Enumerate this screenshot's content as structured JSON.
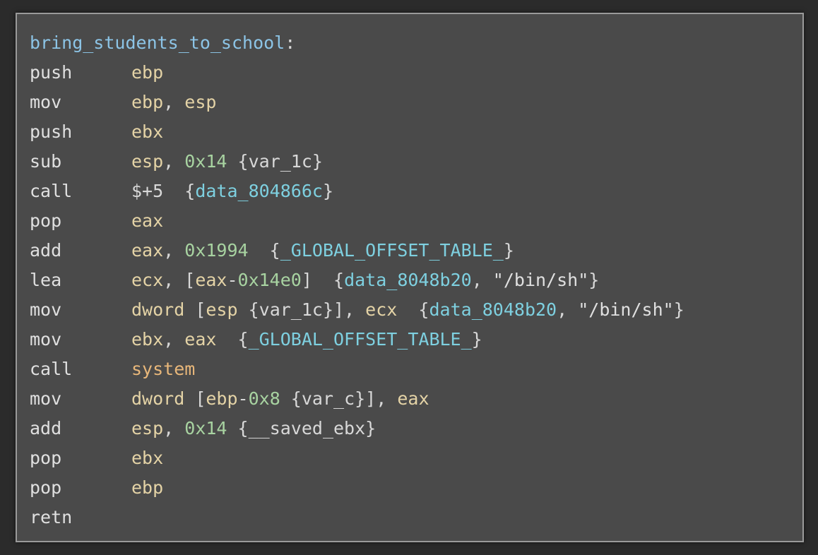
{
  "function_label": "bring_students_to_school",
  "lines": [
    [
      {
        "c": "label",
        "t": "bring_students_to_school"
      },
      {
        "c": "punc",
        "t": ":"
      }
    ],
    [
      {
        "c": "mn",
        "t": "push"
      },
      {
        "c": "reg",
        "t": "ebp"
      }
    ],
    [
      {
        "c": "mn",
        "t": "mov"
      },
      {
        "c": "reg",
        "t": "ebp"
      },
      {
        "c": "punc",
        "t": ", "
      },
      {
        "c": "reg",
        "t": "esp"
      }
    ],
    [
      {
        "c": "mn",
        "t": "push"
      },
      {
        "c": "reg",
        "t": "ebx"
      }
    ],
    [
      {
        "c": "mn",
        "t": "sub"
      },
      {
        "c": "reg",
        "t": "esp"
      },
      {
        "c": "punc",
        "t": ", "
      },
      {
        "c": "num",
        "t": "0x14"
      },
      {
        "c": "punc",
        "t": " {"
      },
      {
        "c": "var",
        "t": "var_1c"
      },
      {
        "c": "punc",
        "t": "}"
      }
    ],
    [
      {
        "c": "mn",
        "t": "call"
      },
      {
        "c": "punc",
        "t": "$+5  {"
      },
      {
        "c": "sym",
        "t": "data_804866c"
      },
      {
        "c": "punc",
        "t": "}"
      }
    ],
    [
      {
        "c": "mn",
        "t": "pop"
      },
      {
        "c": "reg",
        "t": "eax"
      }
    ],
    [
      {
        "c": "mn",
        "t": "add"
      },
      {
        "c": "reg",
        "t": "eax"
      },
      {
        "c": "punc",
        "t": ", "
      },
      {
        "c": "num",
        "t": "0x1994"
      },
      {
        "c": "punc",
        "t": "  {"
      },
      {
        "c": "sym",
        "t": "_GLOBAL_OFFSET_TABLE_"
      },
      {
        "c": "punc",
        "t": "}"
      }
    ],
    [
      {
        "c": "mn",
        "t": "lea"
      },
      {
        "c": "reg",
        "t": "ecx"
      },
      {
        "c": "punc",
        "t": ", ["
      },
      {
        "c": "reg",
        "t": "eax"
      },
      {
        "c": "punc",
        "t": "-"
      },
      {
        "c": "num",
        "t": "0x14e0"
      },
      {
        "c": "punc",
        "t": "]  {"
      },
      {
        "c": "sym",
        "t": "data_8048b20"
      },
      {
        "c": "punc",
        "t": ", "
      },
      {
        "c": "str",
        "t": "\"/bin/sh\""
      },
      {
        "c": "punc",
        "t": "}"
      }
    ],
    [
      {
        "c": "mn",
        "t": "mov"
      },
      {
        "c": "reg",
        "t": "dword"
      },
      {
        "c": "punc",
        "t": " ["
      },
      {
        "c": "reg",
        "t": "esp"
      },
      {
        "c": "punc",
        "t": " {"
      },
      {
        "c": "var",
        "t": "var_1c"
      },
      {
        "c": "punc",
        "t": "}], "
      },
      {
        "c": "reg",
        "t": "ecx"
      },
      {
        "c": "punc",
        "t": "  {"
      },
      {
        "c": "sym",
        "t": "data_8048b20"
      },
      {
        "c": "punc",
        "t": ", "
      },
      {
        "c": "str",
        "t": "\"/bin/sh\""
      },
      {
        "c": "punc",
        "t": "}"
      }
    ],
    [
      {
        "c": "mn",
        "t": "mov"
      },
      {
        "c": "reg",
        "t": "ebx"
      },
      {
        "c": "punc",
        "t": ", "
      },
      {
        "c": "reg",
        "t": "eax"
      },
      {
        "c": "punc",
        "t": "  {"
      },
      {
        "c": "sym",
        "t": "_GLOBAL_OFFSET_TABLE_"
      },
      {
        "c": "punc",
        "t": "}"
      }
    ],
    [
      {
        "c": "mn",
        "t": "call"
      },
      {
        "c": "fn",
        "t": "system"
      }
    ],
    [
      {
        "c": "mn",
        "t": "mov"
      },
      {
        "c": "reg",
        "t": "dword"
      },
      {
        "c": "punc",
        "t": " ["
      },
      {
        "c": "reg",
        "t": "ebp"
      },
      {
        "c": "punc",
        "t": "-"
      },
      {
        "c": "num",
        "t": "0x8"
      },
      {
        "c": "punc",
        "t": " {"
      },
      {
        "c": "var",
        "t": "var_c"
      },
      {
        "c": "punc",
        "t": "}], "
      },
      {
        "c": "reg",
        "t": "eax"
      }
    ],
    [
      {
        "c": "mn",
        "t": "add"
      },
      {
        "c": "reg",
        "t": "esp"
      },
      {
        "c": "punc",
        "t": ", "
      },
      {
        "c": "num",
        "t": "0x14"
      },
      {
        "c": "punc",
        "t": " {"
      },
      {
        "c": "var",
        "t": "__saved_ebx"
      },
      {
        "c": "punc",
        "t": "}"
      }
    ],
    [
      {
        "c": "mn",
        "t": "pop"
      },
      {
        "c": "reg",
        "t": "ebx"
      }
    ],
    [
      {
        "c": "mn",
        "t": "pop"
      },
      {
        "c": "reg",
        "t": "ebp"
      }
    ],
    [
      {
        "c": "mn",
        "t": "retn"
      }
    ]
  ],
  "colors": {
    "background": "#2b2b2b",
    "panel": "#4a4a4a",
    "border": "#9a9a9a",
    "label": "#8cc4e6",
    "register": "#e4d3a6",
    "number": "#a8d3a1",
    "symbol": "#7ed0e0",
    "function": "#e8b77a",
    "text": "#d8d8d8"
  }
}
